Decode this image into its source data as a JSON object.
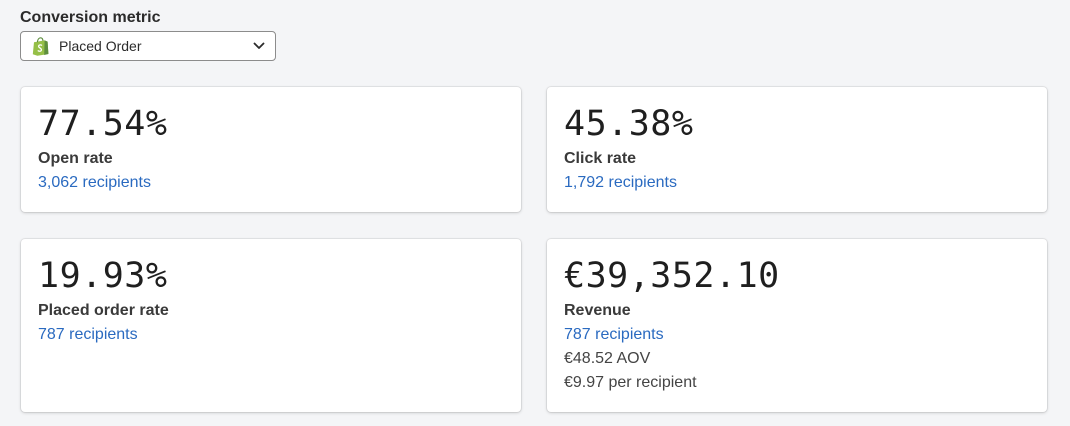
{
  "conversion_metric": {
    "label": "Conversion metric",
    "selected": "Placed Order",
    "icon": "shopify-bag-icon"
  },
  "colors": {
    "link": "#2a6ac0",
    "shopify_green": "#95bf47"
  },
  "cards": [
    {
      "value": "77.54%",
      "title": "Open rate",
      "recipients": "3,062 recipients"
    },
    {
      "value": "45.38%",
      "title": "Click rate",
      "recipients": "1,792 recipients"
    },
    {
      "value": "19.93%",
      "title": "Placed order rate",
      "recipients": "787 recipients"
    },
    {
      "value": "€39,352.10",
      "title": "Revenue",
      "recipients": "787 recipients",
      "aov": "€48.52 AOV",
      "per_recipient": "€9.97 per recipient"
    }
  ]
}
